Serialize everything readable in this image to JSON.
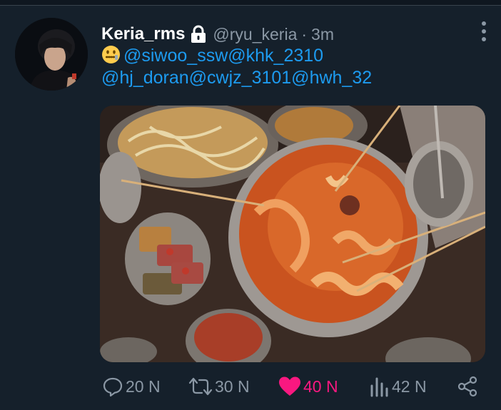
{
  "tweet": {
    "display_name": "Keria_rms",
    "handle": "@ryu_keria",
    "separator": "·",
    "time": "3m",
    "mentions_line1": "@siwoo_ssw@khk_2310",
    "mentions_line2": "@hj_doran@cwjz_3101@hwh_32"
  },
  "actions": {
    "replies": "20 N",
    "retweets": "30 N",
    "likes": "40 N",
    "views": "42 N"
  },
  "icons": [
    "lock-icon",
    "more-icon",
    "reply-icon",
    "retweet-icon",
    "heart-icon",
    "views-icon",
    "share-icon"
  ],
  "colors": {
    "background": "#15202b",
    "link": "#1d9bf0",
    "secondary": "#8b98a5",
    "like": "#f91880"
  }
}
